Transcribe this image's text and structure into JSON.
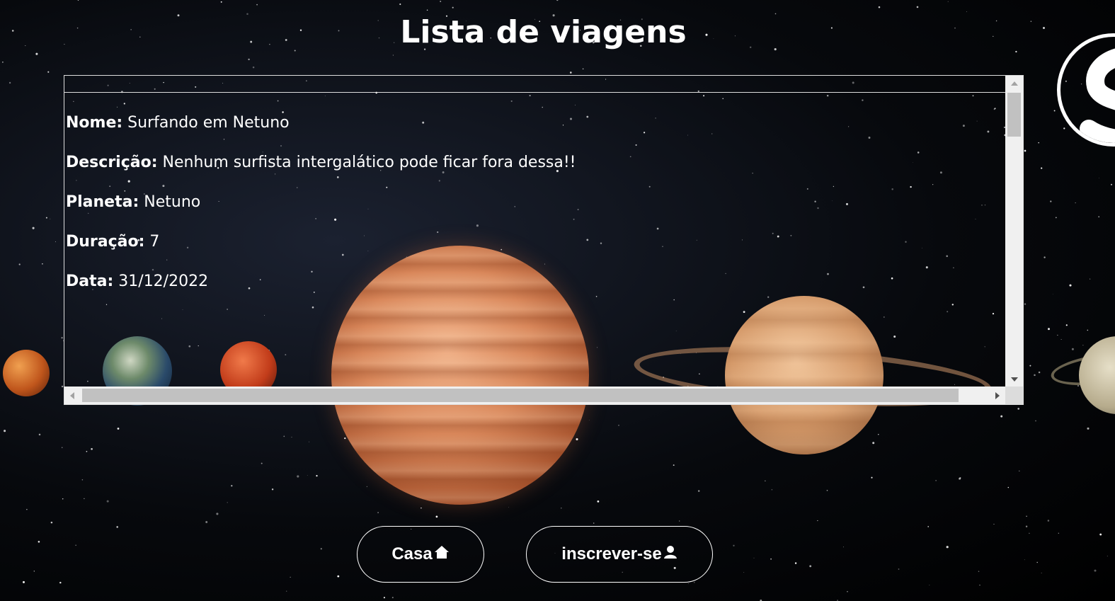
{
  "page": {
    "title": "Lista de viagens"
  },
  "trip": {
    "fields": [
      {
        "label": "Nome:",
        "value": "Surfando em Netuno"
      },
      {
        "label": "Descrição:",
        "value": "Nenhum surfista intergalático pode ficar fora dessa!!"
      },
      {
        "label": "Planeta:",
        "value": "Netuno"
      },
      {
        "label": "Duração:",
        "value": "7"
      },
      {
        "label": "Data:",
        "value": "31/12/2022"
      }
    ]
  },
  "buttons": {
    "home_label": "Casa",
    "home_icon": "home-icon",
    "subscribe_label": "inscrever-se",
    "subscribe_icon": "user-icon"
  },
  "logo": {
    "icon": "brand-logo-icon"
  },
  "colors": {
    "text": "#ffffff",
    "background": "#000000"
  }
}
